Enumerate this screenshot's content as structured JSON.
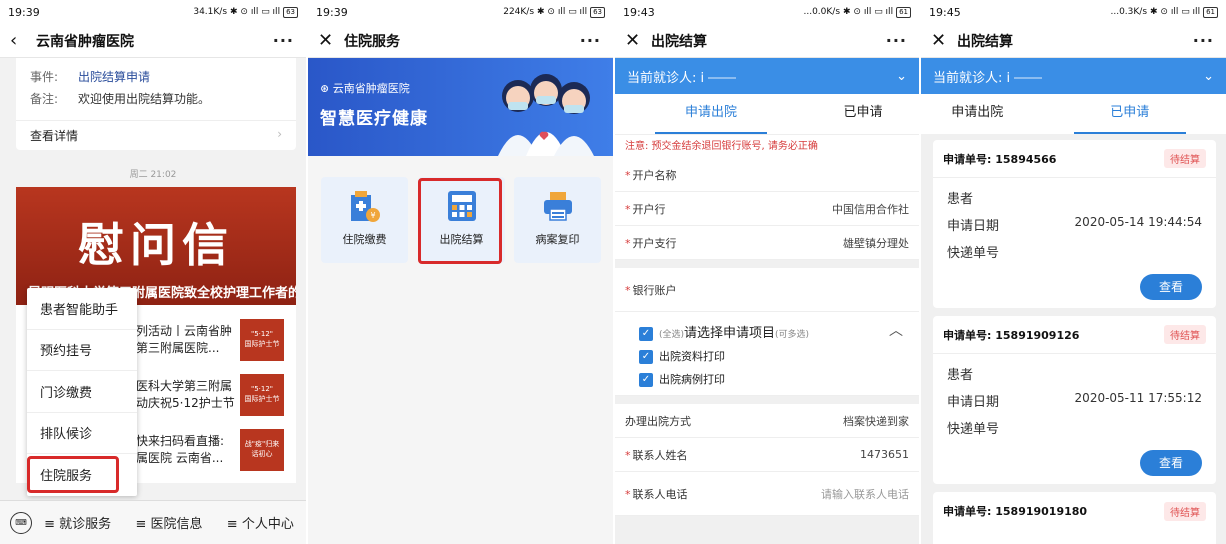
{
  "panel1": {
    "status": {
      "time": "19:39",
      "speed": "34.1K/s",
      "battery": "63"
    },
    "nav_title": "云南省肿瘤医院",
    "message": {
      "event_label": "事件:",
      "event_value": "出院结算申请",
      "note_label": "备注:",
      "note_value": "欢迎使用出院结算功能。",
      "detail_label": "查看详情"
    },
    "timestamp": "周二 21:02",
    "banner_title": "慰问信",
    "banner_sub": "昆明医科大学第三附属医院致全校护理工作者的慰问信",
    "news": [
      {
        "text1": "列活动丨云南省肿",
        "text2": "第三附属医院...",
        "thumb1": "\"5·12\"",
        "thumb2": "国际护士节"
      },
      {
        "text1": "医科大学第三附属",
        "text2": "动庆祝5·12护士节",
        "thumb1": "\"5·12\"",
        "thumb2": "国际护士节"
      },
      {
        "text1": "快来扫码看直播:",
        "text2": "属医院 云南省...",
        "thumb1": "战\"疫\"归来",
        "thumb2": "话初心"
      }
    ],
    "popup_items": [
      "患者智能助手",
      "预约挂号",
      "门诊缴费",
      "排队候诊",
      "住院服务"
    ],
    "bottom_menu": [
      "≡ 就诊服务",
      "≡ 医院信息",
      "≡ 个人中心"
    ]
  },
  "panel2": {
    "status": {
      "time": "19:39",
      "speed": "224K/s",
      "battery": "63"
    },
    "nav_title": "住院服务",
    "banner_logo": "云南省肿瘤医院",
    "banner_slogan": "智慧医疗健康",
    "services": [
      "住院缴费",
      "出院结算",
      "病案复印"
    ]
  },
  "panel3": {
    "status": {
      "time": "19:43",
      "speed": "...0.0K/s",
      "battery": "61"
    },
    "nav_title": "出院结算",
    "patient_label": "当前就诊人: i",
    "tabs": [
      "申请出院",
      "已申请"
    ],
    "warning": "注意: 预交金结余退回银行账号, 请务必正确",
    "fields": [
      {
        "label": "开户名称",
        "value": ""
      },
      {
        "label": "开户行",
        "value": "中国信用合作社"
      },
      {
        "label": "开户支行",
        "value": "雄壁镇分理处"
      },
      {
        "label": "银行账户",
        "value": ""
      }
    ],
    "select_all": "(全选)",
    "select_title": "请选择申请项目",
    "select_hint": "(可多选)",
    "items": [
      "出院资料打印",
      "出院病例打印"
    ],
    "method_label": "办理出院方式",
    "method_value": "档案快递到家",
    "contact_name_label": "联系人姓名",
    "contact_name_value": "1473651",
    "contact_phone_label": "联系人电话",
    "contact_phone_placeholder": "请输入联系人电话"
  },
  "panel4": {
    "status": {
      "time": "19:45",
      "speed": "...0.3K/s",
      "battery": "61"
    },
    "nav_title": "出院结算",
    "patient_label": "当前就诊人: i",
    "tabs": [
      "申请出院",
      "已申请"
    ],
    "applications": [
      {
        "number": "申请单号: 15894566",
        "status": "待结算",
        "patient_label": "患者",
        "date_label": "申请日期",
        "date": "2020-05-14 19:44:54",
        "express_label": "快递单号",
        "button": "查看"
      },
      {
        "number": "申请单号: 15891909126",
        "status": "待结算",
        "patient_label": "患者",
        "date_label": "申请日期",
        "date": "2020-05-11 17:55:12",
        "express_label": "快递单号",
        "button": "查看"
      },
      {
        "number": "申请单号: 158919019180",
        "status": "待结算"
      }
    ]
  },
  "colors": {
    "primary_blue": "#3a8ee6",
    "highlight_red": "#d82a2a",
    "warning_red": "#d63b3b",
    "banner_red": "#b8361f"
  }
}
